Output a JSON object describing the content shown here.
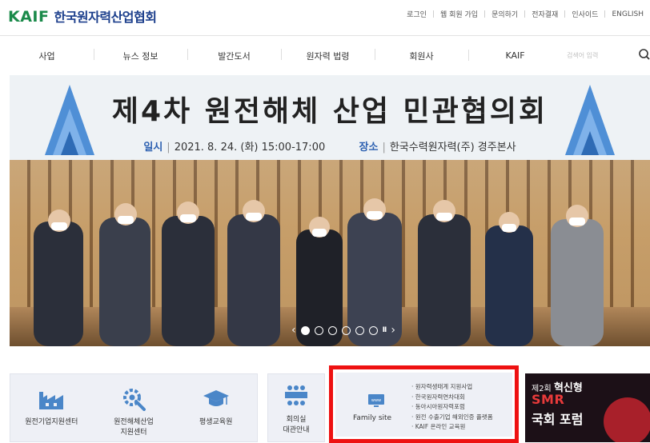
{
  "header": {
    "logo_mark": "KAIF",
    "logo_text": "한국원자력산업협회",
    "util_links": [
      "로그인",
      "웹 회원 가입",
      "문의하기",
      "전자결재",
      "인사이드",
      "ENGLISH"
    ]
  },
  "nav": {
    "items": [
      "사업",
      "뉴스 정보",
      "발간도서",
      "원자력 법령",
      "회원사",
      "KAIF"
    ],
    "search_placeholder": "검색어 입력"
  },
  "banner": {
    "title": "제4차 원전해체 산업 민관협의회",
    "when_label": "일시",
    "when_value": "2021. 8. 24. (화) 15:00-17:00",
    "where_label": "장소",
    "where_value": "한국수력원자력(주) 경주본사",
    "slide_count": 6,
    "active_slide": 1
  },
  "quick_links": [
    {
      "label": "원전기업지원센터",
      "icon": "factory-icon"
    },
    {
      "label": "원전해체산업\n지원센터",
      "icon": "gear-wrench-icon"
    },
    {
      "label": "평생교육원",
      "icon": "graduation-cap-icon"
    }
  ],
  "meeting_room": {
    "label": "회의실\n대관안내",
    "icon": "meeting-room-icon"
  },
  "family_site": {
    "label": "Family site",
    "links": [
      "· 원자력생태계 지원사업",
      "· 한국원자력연차대회",
      "· 동아시아원자력포럼",
      "· 원전 수출기업 해외인증 플랫폼",
      "· KAIF 온라인 교육원"
    ]
  },
  "promo": {
    "line1": "제2회",
    "line1_bold": "혁신형",
    "line2": "SMR",
    "line3": "국회 포럼",
    "small": "",
    "mini": ""
  },
  "colors": {
    "brand_green": "#1a8a4a",
    "brand_blue": "#1c3f8c",
    "highlight_red": "#ee1111",
    "tile_bg": "#eef0f6",
    "tile_icon": "#4a86c8"
  }
}
